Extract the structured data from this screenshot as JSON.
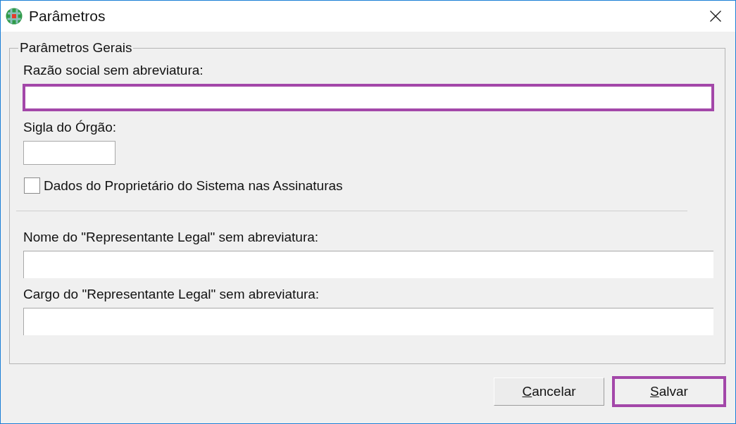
{
  "window": {
    "title": "Parâmetros"
  },
  "group": {
    "title": "Parâmetros Gerais",
    "sections": [
      {
        "items": [
          {
            "kind": "field",
            "label": "Razão social sem abreviatura:",
            "highlighted": true
          },
          {
            "kind": "shortfield",
            "label": "Sigla do Órgão:",
            "highlighted": false
          },
          {
            "kind": "checkbox",
            "label": "Dados do Proprietário do Sistema nas Assinaturas",
            "checked": false
          }
        ]
      },
      {
        "items": [
          {
            "kind": "field",
            "label": "Nome do \"Representante Legal\" sem abreviatura:",
            "highlighted": false
          },
          {
            "kind": "field",
            "label": "Cargo do \"Representante Legal\" sem abreviatura:",
            "highlighted": false
          }
        ]
      }
    ]
  },
  "buttons": [
    {
      "label": "Cancelar",
      "access_key_underlined": true,
      "highlighted": false
    },
    {
      "label": "Salvar",
      "access_key_underlined": true,
      "highlighted": true
    }
  ]
}
